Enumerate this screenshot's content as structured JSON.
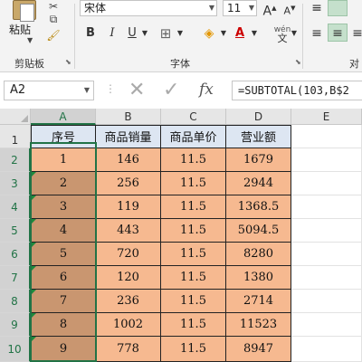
{
  "ribbon": {
    "paste_label": "粘贴",
    "clipboard_group": "剪贴板",
    "font_group": "字体",
    "partial_group": "对",
    "font_name": "宋体",
    "font_size": "11",
    "bold": "B",
    "italic": "I",
    "underline": "U",
    "grow_font": "A",
    "shrink_font": "A",
    "phonetic": "wén",
    "font_color_letter": "A"
  },
  "formula_bar": {
    "name_box": "A2",
    "fx": "fx",
    "formula": "=SUBTOTAL(103,B$2"
  },
  "columns": [
    "A",
    "B",
    "C",
    "D",
    "E"
  ],
  "row_numbers": [
    "1",
    "2",
    "3",
    "4",
    "5",
    "6",
    "7",
    "8",
    "9",
    "10"
  ],
  "table": {
    "headers": [
      "序号",
      "商品销量",
      "商品单价",
      "营业额"
    ],
    "rows": [
      [
        "1",
        "146",
        "11.5",
        "1679"
      ],
      [
        "2",
        "256",
        "11.5",
        "2944"
      ],
      [
        "3",
        "119",
        "11.5",
        "1368.5"
      ],
      [
        "4",
        "443",
        "11.5",
        "5094.5"
      ],
      [
        "5",
        "720",
        "11.5",
        "8280"
      ],
      [
        "6",
        "120",
        "11.5",
        "1380"
      ],
      [
        "7",
        "236",
        "11.5",
        "2714"
      ],
      [
        "8",
        "1002",
        "11.5",
        "11523"
      ],
      [
        "9",
        "778",
        "11.5",
        "8947"
      ]
    ]
  },
  "colors": {
    "accent": "#217346",
    "header_fill": "#dde6f2",
    "data_fill": "#f6b990",
    "selected_fill": "#c99670"
  }
}
